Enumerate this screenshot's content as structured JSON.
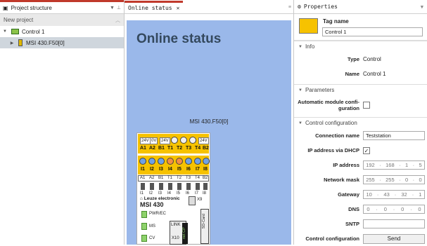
{
  "left_panel": {
    "title": "Project structure",
    "section": "New project",
    "tree": [
      {
        "label": "Control 1",
        "expanded": true
      },
      {
        "label": "MSI 430.F50[0]"
      }
    ]
  },
  "center_panel": {
    "tab_title": "Online status",
    "tab_close": "✕",
    "heading": "Online status",
    "device_name": "MSI 430.F50[0]",
    "device": {
      "top_small": [
        "24V",
        "0V",
        "24V",
        "24V"
      ],
      "top_labels": [
        "A1",
        "A2",
        "B1",
        "T1",
        "T2",
        "T3",
        "T4",
        "B2"
      ],
      "mid_labels": [
        "I1",
        "I2",
        "I3",
        "I4",
        "I5",
        "I6",
        "I7",
        "I8"
      ],
      "strip_labels": [
        "A1",
        "A2",
        "B1",
        "T1",
        "T2",
        "T3",
        "T4",
        "B2"
      ],
      "bottom_labels": [
        "I1",
        "I2",
        "I3",
        "I4",
        "I5",
        "I6",
        "I7",
        "I8"
      ],
      "brand": "Leuze electronic",
      "model": "MSI 430",
      "x9": "X9",
      "status": [
        "PWR/EC",
        "MS",
        "CV"
      ],
      "link": "LINK",
      "x10": "X10",
      "sdcard": "SD-Card",
      "netcp": "net CP"
    }
  },
  "right_panel": {
    "title": "Properties",
    "tag_label": "Tag name",
    "tag_value": "Control 1",
    "info_header": "Info",
    "type_label": "Type",
    "type_value": "Control",
    "name_label": "Name",
    "name_value": "Control 1",
    "params_header": "Parameters",
    "auto_config_label_1": "Automatic module confi-",
    "auto_config_label_2": "guration",
    "ctrl_header": "Control configuration",
    "connection_label": "Connection name",
    "connection_value": "Teststation",
    "dhcp_label": "IP address via DHCP",
    "ip_label": "IP address",
    "ip": [
      "192",
      "168",
      "1",
      "5"
    ],
    "mask_label": "Network mask",
    "mask": [
      "255",
      "255",
      "0",
      "0"
    ],
    "gateway_label": "Gateway",
    "gateway": [
      "10",
      "43",
      "32",
      "1"
    ],
    "dns_label": "DNS",
    "dns": [
      "0",
      "0",
      "0",
      "0"
    ],
    "sntp_label": "SNTP",
    "ctrl_conf_label": "Control configuration",
    "send_label": "Send"
  }
}
